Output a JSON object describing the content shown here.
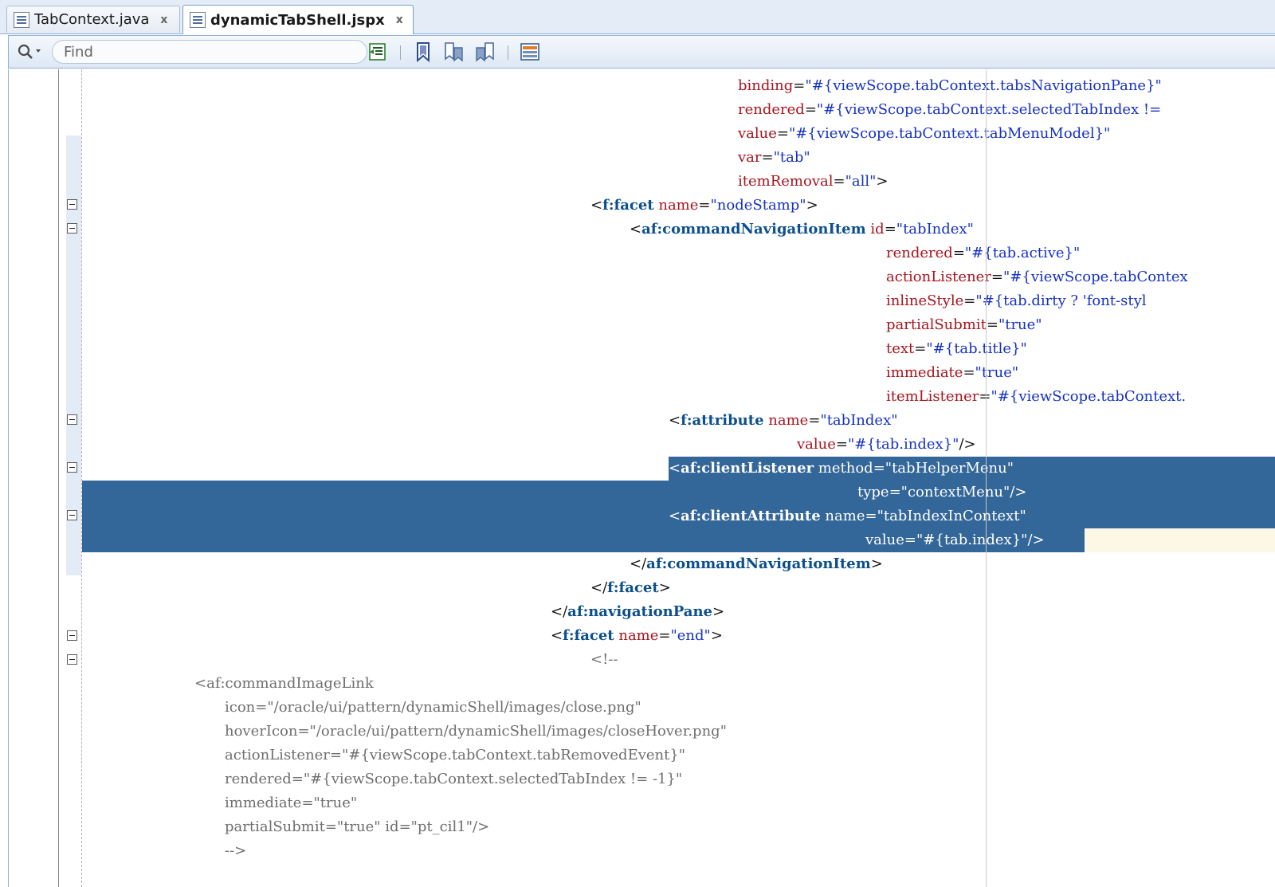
{
  "tabs": [
    {
      "label": "TabContext.java",
      "close": "x",
      "active": false
    },
    {
      "label": "dynamicTabShell.jspx",
      "close": "x",
      "active": true
    }
  ],
  "toolbar": {
    "search_placeholder": "Find",
    "icons": [
      "search-icon",
      "reformat-icon",
      "bookmark-icon",
      "previous-bookmark-icon",
      "next-bookmark-icon",
      "toggle-panel-icon"
    ]
  },
  "colors": {
    "tag": "#0b4f8c",
    "attribute": "#a8141e",
    "value": "#1531c4",
    "comment": "#6e6e6e",
    "selection": "#336699",
    "caret_line": "#fdf8e6"
  },
  "code": {
    "lines": [
      {
        "i": "",
        "p": [
          [
            "attr",
            "binding"
          ],
          [
            "txt",
            "="
          ],
          [
            "val",
            "\"#{viewScope.tabContext.tabsNavigationPane}\""
          ]
        ]
      },
      {
        "i": "",
        "p": [
          [
            "attr",
            "rendered"
          ],
          [
            "txt",
            "="
          ],
          [
            "val",
            "\"#{viewScope.tabContext.selectedTabIndex !="
          ]
        ]
      },
      {
        "i": "",
        "p": [
          [
            "attr",
            "value"
          ],
          [
            "txt",
            "="
          ],
          [
            "val",
            "\"#{viewScope.tabContext.tabMenuModel}\""
          ]
        ]
      },
      {
        "i": "",
        "p": [
          [
            "attr",
            "var"
          ],
          [
            "txt",
            "="
          ],
          [
            "val",
            "\"tab\""
          ]
        ]
      },
      {
        "i": "",
        "p": [
          [
            "attr",
            "itemRemoval"
          ],
          [
            "txt",
            "="
          ],
          [
            "val",
            "\"all\""
          ],
          [
            "txt",
            ">"
          ]
        ]
      },
      {
        "i": "",
        "p": [
          [
            "txt",
            "<"
          ],
          [
            "tag",
            "f:facet"
          ],
          [
            "txt",
            " "
          ],
          [
            "attr",
            "name"
          ],
          [
            "txt",
            "="
          ],
          [
            "val",
            "\"nodeStamp\""
          ],
          [
            "txt",
            ">"
          ]
        ]
      },
      {
        "i": "",
        "p": [
          [
            "txt",
            "<"
          ],
          [
            "tag",
            "af:commandNavigationItem"
          ],
          [
            "txt",
            " "
          ],
          [
            "attr",
            "id"
          ],
          [
            "txt",
            "="
          ],
          [
            "val",
            "\"tabIndex\""
          ]
        ]
      },
      {
        "i": "",
        "p": [
          [
            "attr",
            "rendered"
          ],
          [
            "txt",
            "="
          ],
          [
            "val",
            "\"#{tab.active}\""
          ]
        ]
      },
      {
        "i": "",
        "p": [
          [
            "attr",
            "actionListener"
          ],
          [
            "txt",
            "="
          ],
          [
            "val",
            "\"#{viewScope.tabContex"
          ]
        ]
      },
      {
        "i": "",
        "p": [
          [
            "attr",
            "inlineStyle"
          ],
          [
            "txt",
            "="
          ],
          [
            "val",
            "\"#{tab.dirty ? 'font-styl"
          ]
        ]
      },
      {
        "i": "",
        "p": [
          [
            "attr",
            "partialSubmit"
          ],
          [
            "txt",
            "="
          ],
          [
            "val",
            "\"true\""
          ]
        ]
      },
      {
        "i": "",
        "p": [
          [
            "attr",
            "text"
          ],
          [
            "txt",
            "="
          ],
          [
            "val",
            "\"#{tab.title}\""
          ]
        ]
      },
      {
        "i": "",
        "p": [
          [
            "attr",
            "immediate"
          ],
          [
            "txt",
            "="
          ],
          [
            "val",
            "\"true\""
          ]
        ]
      },
      {
        "i": "",
        "p": [
          [
            "attr",
            "itemListener"
          ],
          [
            "txt",
            "="
          ],
          [
            "val",
            "\"#{viewScope.tabContext."
          ]
        ]
      },
      {
        "i": "",
        "p": [
          [
            "txt",
            "<"
          ],
          [
            "tag",
            "f:attribute"
          ],
          [
            "txt",
            " "
          ],
          [
            "attr",
            "name"
          ],
          [
            "txt",
            "="
          ],
          [
            "val",
            "\"tabIndex\""
          ]
        ]
      },
      {
        "i": "",
        "p": [
          [
            "attr",
            "value"
          ],
          [
            "txt",
            "="
          ],
          [
            "val",
            "\"#{tab.index}\""
          ],
          [
            "txt",
            "/>"
          ]
        ]
      },
      {
        "i": "",
        "p": [
          [
            "txt",
            "<"
          ],
          [
            "tag",
            "af:clientListener"
          ],
          [
            "txt",
            " "
          ],
          [
            "attr",
            "method"
          ],
          [
            "txt",
            "="
          ],
          [
            "val",
            "\"tabHelperMenu\""
          ]
        ]
      },
      {
        "i": "",
        "p": [
          [
            "attr",
            "type"
          ],
          [
            "txt",
            "="
          ],
          [
            "val",
            "\"contextMenu\""
          ],
          [
            "txt",
            "/>"
          ]
        ]
      },
      {
        "i": "",
        "p": [
          [
            "txt",
            "<"
          ],
          [
            "tag",
            "af:clientAttribute"
          ],
          [
            "txt",
            " "
          ],
          [
            "attr",
            "name"
          ],
          [
            "txt",
            "="
          ],
          [
            "val",
            "\"tabIndexInContext\""
          ]
        ]
      },
      {
        "i": "",
        "p": [
          [
            "attr",
            "value"
          ],
          [
            "txt",
            "="
          ],
          [
            "val",
            "\"#{tab.index}\""
          ],
          [
            "txt",
            "/>"
          ]
        ]
      },
      {
        "i": "",
        "p": [
          [
            "txt",
            "</"
          ],
          [
            "tag",
            "af:commandNavigationItem"
          ],
          [
            "txt",
            ">"
          ]
        ]
      },
      {
        "i": "",
        "p": [
          [
            "txt",
            "</"
          ],
          [
            "tag",
            "f:facet"
          ],
          [
            "txt",
            ">"
          ]
        ]
      },
      {
        "i": "",
        "p": [
          [
            "txt",
            "</"
          ],
          [
            "tag",
            "af:navigationPane"
          ],
          [
            "txt",
            ">"
          ]
        ]
      },
      {
        "i": "",
        "p": [
          [
            "txt",
            "<"
          ],
          [
            "tag",
            "f:facet"
          ],
          [
            "txt",
            " "
          ],
          [
            "attr",
            "name"
          ],
          [
            "txt",
            "="
          ],
          [
            "val",
            "\"end\""
          ],
          [
            "txt",
            ">"
          ]
        ]
      },
      {
        "i": "",
        "p": [
          [
            "cmt",
            "<!--"
          ]
        ]
      },
      {
        "i": "",
        "p": [
          [
            "cmt",
            "<af:commandImageLink"
          ]
        ]
      },
      {
        "i": "",
        "p": [
          [
            "cmt",
            "icon=\"/oracle/ui/pattern/dynamicShell/images/close.png\""
          ]
        ]
      },
      {
        "i": "",
        "p": [
          [
            "cmt",
            "hoverIcon=\"/oracle/ui/pattern/dynamicShell/images/closeHover.png\""
          ]
        ]
      },
      {
        "i": "",
        "p": [
          [
            "cmt",
            "actionListener=\"#{viewScope.tabContext.tabRemovedEvent}\""
          ]
        ]
      },
      {
        "i": "",
        "p": [
          [
            "cmt",
            "rendered=\"#{viewScope.tabContext.selectedTabIndex != -1}\""
          ]
        ]
      },
      {
        "i": "",
        "p": [
          [
            "cmt",
            "immediate=\"true\""
          ]
        ]
      },
      {
        "i": "",
        "p": [
          [
            "cmt",
            "partialSubmit=\"true\" id=\"pt_cil1\"/>"
          ]
        ]
      },
      {
        "i": "",
        "p": [
          [
            "cmt",
            "-->"
          ]
        ]
      }
    ]
  }
}
